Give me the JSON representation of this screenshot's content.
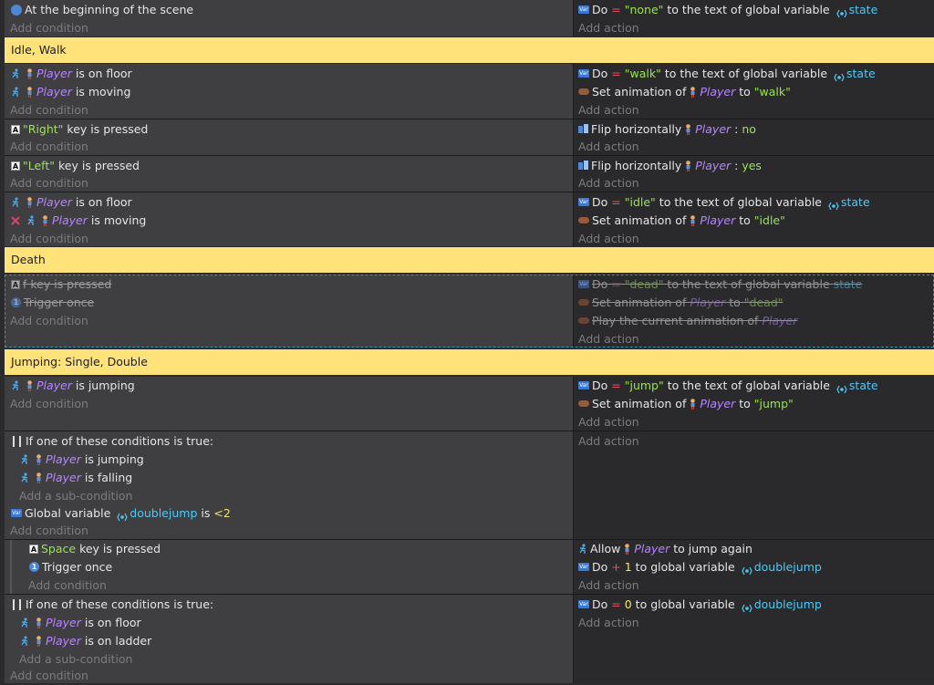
{
  "events": [
    {
      "conditions": [
        {
          "text": "At the beginning of the scene"
        }
      ],
      "actions": [
        {
          "pre": "Do",
          "op": "=",
          "val": "\"none\"",
          "mid": "to the text of global variable",
          "var": "state"
        }
      ]
    },
    {
      "group": "Idle, Walk"
    },
    {
      "conditions": [
        {
          "obj": "Player",
          "text": "is on floor"
        },
        {
          "obj": "Player",
          "text": "is moving"
        }
      ],
      "actions": [
        {
          "pre": "Do",
          "op": "=",
          "val": "\"walk\"",
          "mid": "to the text of global variable",
          "var": "state"
        },
        {
          "pre": "Set animation of",
          "obj": "Player",
          "mid": "to",
          "val": "\"walk\""
        }
      ]
    },
    {
      "conditions": [
        {
          "key": "\"Right\"",
          "text": "key is pressed"
        }
      ],
      "actions": [
        {
          "pre": "Flip horizontally",
          "obj": "Player",
          "sep": ":",
          "flag": "no"
        }
      ]
    },
    {
      "conditions": [
        {
          "key": "\"Left\"",
          "text": "key is pressed"
        }
      ],
      "actions": [
        {
          "pre": "Flip horizontally",
          "obj": "Player",
          "sep": ":",
          "flag": "yes"
        }
      ]
    },
    {
      "conditions": [
        {
          "obj": "Player",
          "text": "is on floor"
        },
        {
          "obj": "Player",
          "text": "is moving"
        }
      ],
      "actions": [
        {
          "pre": "Do",
          "op": "=",
          "val": "\"idle\"",
          "mid": "to the text of global variable",
          "var": "state"
        },
        {
          "pre": "Set animation of",
          "obj": "Player",
          "mid": "to",
          "val": "\"idle\""
        }
      ]
    },
    {
      "group": "Death"
    },
    {
      "disabled": true,
      "conditions": [
        {
          "text": "f key is pressed"
        },
        {
          "text": "Trigger once"
        }
      ],
      "actions": [
        {
          "pre": "Do",
          "op": "=",
          "val": "\"dead\"",
          "mid": "to the text of global variable",
          "var": "state"
        },
        {
          "pre": "Set animation of",
          "obj": "Player",
          "mid": "to",
          "val": "\"dead\""
        },
        {
          "pre": "Play the current animation of",
          "obj": "Player"
        }
      ]
    },
    {
      "group": "Jumping: Single, Double"
    },
    {
      "conditions": [
        {
          "obj": "Player",
          "text": "is jumping"
        }
      ],
      "actions": [
        {
          "pre": "Do",
          "op": "=",
          "val": "\"jump\"",
          "mid": "to the text of global variable",
          "var": "state"
        },
        {
          "pre": "Set animation of",
          "obj": "Player",
          "mid": "to",
          "val": "\"jump\""
        }
      ]
    },
    {
      "conditions": [
        {
          "text": "If one of these conditions is true:"
        },
        {
          "obj": "Player",
          "text": "is jumping"
        },
        {
          "obj": "Player",
          "text": "is falling"
        },
        {
          "pre": "Global variable",
          "var": "doublejump",
          "mid": "is",
          "op": "<",
          "num": "2"
        }
      ],
      "actions": []
    },
    {
      "sub": true,
      "conditions": [
        {
          "key": "Space",
          "text": "key is pressed"
        },
        {
          "text": "Trigger once"
        }
      ],
      "actions": [
        {
          "pre": "Allow",
          "obj": "Player",
          "mid": "to jump again"
        },
        {
          "pre": "Do",
          "op": "+",
          "num": "1",
          "mid": "to global variable",
          "var": "doublejump"
        }
      ]
    },
    {
      "conditions": [
        {
          "text": "If one of these conditions is true:"
        },
        {
          "obj": "Player",
          "text": "is on floor"
        },
        {
          "obj": "Player",
          "text": "is on ladder"
        }
      ],
      "actions": [
        {
          "pre": "Do",
          "op": "=",
          "num": "0",
          "mid": "to global variable",
          "var": "doublejump"
        }
      ]
    }
  ],
  "labels": {
    "add_condition": "Add condition",
    "add_action": "Add action",
    "add_sub_condition": "Add a sub-condition"
  },
  "colors": {
    "group_bg": "#ffe27a",
    "object": "#b784ff",
    "string": "#9be254",
    "variable": "#4ec9f5"
  },
  "icons": [
    "scene-start-icon",
    "runner-icon",
    "person-icon",
    "key-icon",
    "variable-icon",
    "animation-icon",
    "flip-icon",
    "trigger-once-icon",
    "or-condition-icon",
    "global-variable-icon"
  ]
}
